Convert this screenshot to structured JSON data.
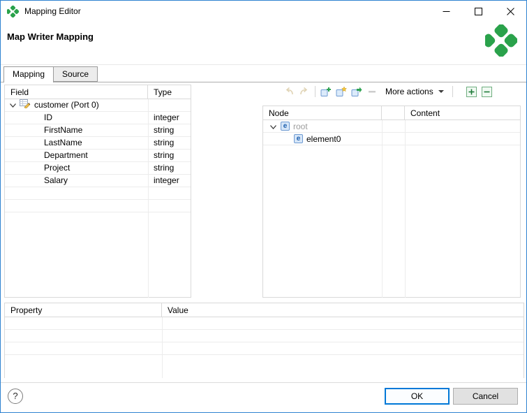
{
  "window": {
    "title": "Mapping Editor"
  },
  "header": {
    "title": "Map Writer Mapping"
  },
  "tabs": {
    "mapping": "Mapping",
    "source": "Source"
  },
  "field_table": {
    "columns": {
      "field": "Field",
      "type": "Type"
    },
    "root": {
      "label": "customer (Port 0)"
    },
    "rows": [
      {
        "field": "ID",
        "type": "integer"
      },
      {
        "field": "FirstName",
        "type": "string"
      },
      {
        "field": "LastName",
        "type": "string"
      },
      {
        "field": "Department",
        "type": "string"
      },
      {
        "field": "Project",
        "type": "string"
      },
      {
        "field": "Salary",
        "type": "integer"
      }
    ]
  },
  "toolbar": {
    "more_actions": "More actions"
  },
  "node_table": {
    "columns": {
      "node": "Node",
      "content": "Content"
    },
    "element_glyph": "e",
    "rows": [
      {
        "label": "root"
      },
      {
        "label": "element0"
      }
    ]
  },
  "property_table": {
    "columns": {
      "property": "Property",
      "value": "Value"
    }
  },
  "footer": {
    "help": "?",
    "ok": "OK",
    "cancel": "Cancel"
  },
  "colors": {
    "accent": "#0078d7",
    "clover_green": "#2aa24b",
    "grid_line": "#ececec"
  }
}
